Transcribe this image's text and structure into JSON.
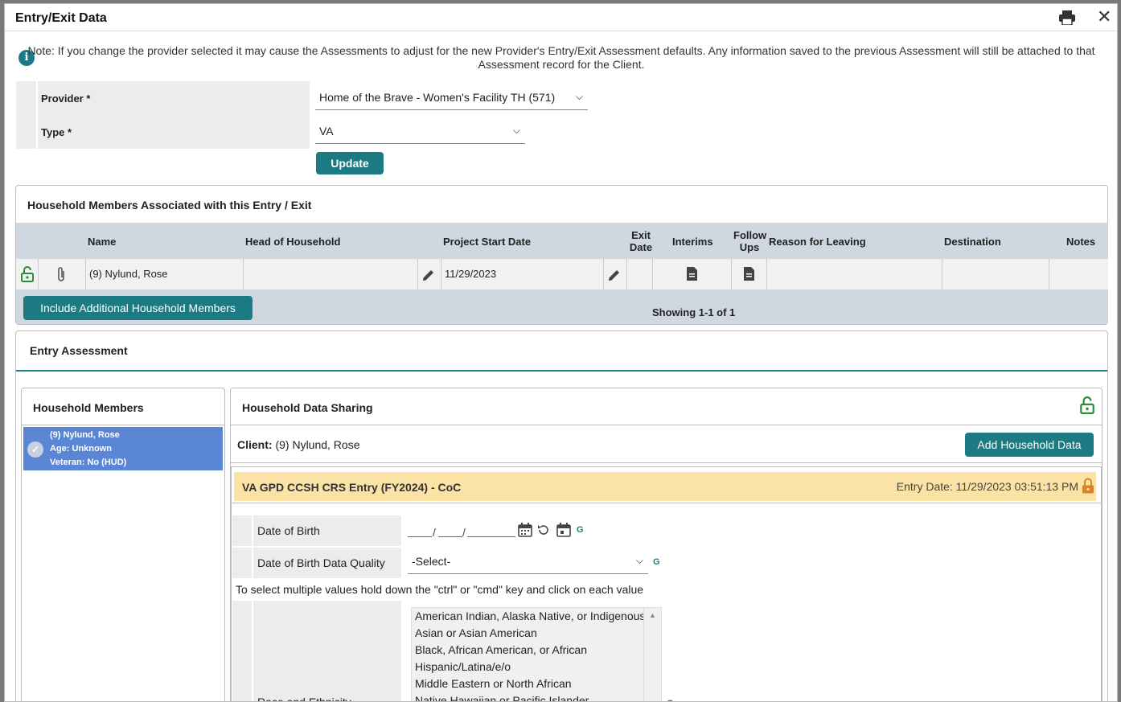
{
  "window": {
    "title": "Entry/Exit Data",
    "close_glyph": "✕"
  },
  "note": {
    "icon": "info-icon",
    "text": "Note: If you change the provider selected it may cause the Assessments to adjust for the new Provider's Entry/Exit Assessment defaults. Any information saved to the previous Assessment will still be attached to that Assessment record for the Client."
  },
  "form": {
    "provider_label": "Provider *",
    "provider_value": "Home of the Brave - Women's Facility TH (571)",
    "type_label": "Type *",
    "type_value": "VA",
    "update_label": "Update"
  },
  "household": {
    "title": "Household Members Associated with this Entry / Exit",
    "columns": [
      "Name",
      "Head of Household",
      "Project Start Date",
      "Exit Date",
      "Interims",
      "Follow Ups",
      "Reason for Leaving",
      "Destination",
      "Notes"
    ],
    "rows": [
      {
        "name": "(9) Nylund, Rose",
        "head": "",
        "start_date": "11/29/2023",
        "exit_date": "",
        "reason": "",
        "destination": "",
        "notes": ""
      }
    ],
    "include_button": "Include Additional Household Members",
    "showing": "Showing 1-1 of 1"
  },
  "entry_assessment": {
    "title": "Entry Assessment",
    "members_title": "Household Members",
    "member": {
      "name": "(9) Nylund, Rose",
      "age": "Age: Unknown",
      "veteran": "Veteran: No (HUD)"
    },
    "sharing_title": "Household Data Sharing",
    "client_label": "Client:",
    "client_value": "(9) Nylund, Rose",
    "add_data_button": "Add Household Data",
    "assessment_name": "VA GPD CCSH CRS Entry (FY2024) - CoC",
    "entry_date": "Entry Date: 11/29/2023 03:51:13 PM",
    "dob_label": "Date of Birth",
    "dob_sep": "/",
    "dob_quality_label": "Date of Birth Data Quality",
    "dob_quality_value": "-Select-",
    "g_link": "G",
    "multi_hint": "To select multiple values hold down the \"ctrl\" or \"cmd\" key and click on each value",
    "race_label": "Race and Ethnicity",
    "race_options": [
      "American Indian, Alaska Native, or Indigenous",
      "Asian or Asian American",
      "Black, African American, or African",
      "Hispanic/Latina/e/o",
      "Middle Eastern or North African",
      "Native Hawaiian or Pacific Islander"
    ]
  },
  "colors": {
    "accent": "#1c7a82",
    "selected": "#5b86d6",
    "assessment_bar": "#fbe3a6",
    "lock_green": "#2e8b3a",
    "lock_orange": "#d9822b"
  }
}
